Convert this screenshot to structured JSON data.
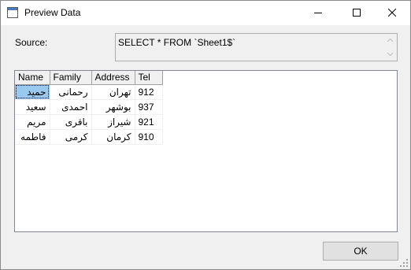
{
  "window": {
    "title": "Preview Data",
    "icon": "app-window-icon"
  },
  "titlebar": {
    "minimize_icon": "minimize-icon",
    "maximize_icon": "maximize-icon",
    "close_icon": "close-icon"
  },
  "source": {
    "label": "Source:",
    "query": "SELECT * FROM `Sheet1$`"
  },
  "grid": {
    "columns": [
      "Name",
      "Family",
      "Address",
      "Tel"
    ],
    "rows": [
      [
        "حمید",
        "رحمانی",
        "تهران",
        "912"
      ],
      [
        "سعید",
        "احمدی",
        "بوشهر",
        "937"
      ],
      [
        "مریم",
        "باقری",
        "شیراز",
        "921"
      ],
      [
        "فاطمه",
        "کرمی",
        "کرمان",
        "910"
      ]
    ],
    "selected_row": 0,
    "selected_col": 0,
    "selection_color": "#99c9ef"
  },
  "buttons": {
    "ok_label": "OK"
  }
}
